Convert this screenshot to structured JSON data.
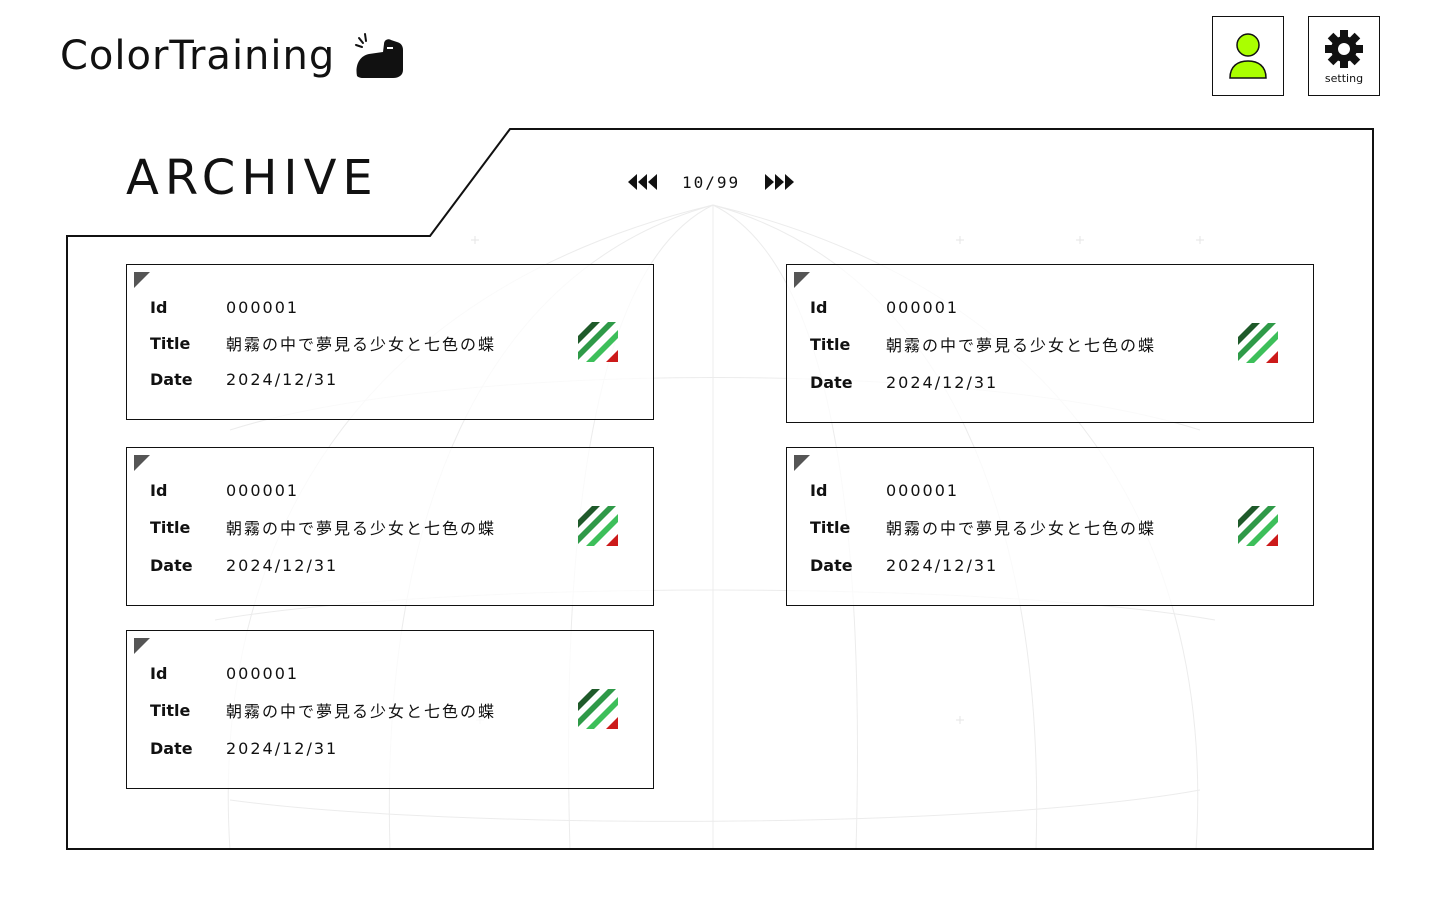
{
  "app": {
    "logo_text": "ColorTraining",
    "logo_icon": "flexed-arm-icon"
  },
  "header": {
    "user_icon": "user-icon",
    "user_icon_color": "#aaff00",
    "setting_icon": "gear-icon",
    "setting_label": "setting"
  },
  "archive": {
    "title": "ARCHIVE",
    "pager": {
      "text": "10/99",
      "prev_icon": "triple-chevron-left-icon",
      "next_icon": "triple-chevron-right-icon"
    },
    "labels": {
      "id": "Id",
      "title": "Title",
      "date": "Date"
    },
    "cards": [
      {
        "id": "000001",
        "title": "朝霧の中で夢見る少女と七色の蝶",
        "date": "2024/12/31"
      },
      {
        "id": "000001",
        "title": "朝霧の中で夢見る少女と七色の蝶",
        "date": "2024/12/31"
      },
      {
        "id": "000001",
        "title": "朝霧の中で夢見る少女と七色の蝶",
        "date": "2024/12/31"
      },
      {
        "id": "000001",
        "title": "朝霧の中で夢見る少女と七色の蝶",
        "date": "2024/12/31"
      },
      {
        "id": "000001",
        "title": "朝霧の中で夢見る少女と七色の蝶",
        "date": "2024/12/31"
      }
    ],
    "swatch_colors": [
      "#1f5a2a",
      "#2f9a48",
      "#3dbf5a",
      "#cc1a1a"
    ]
  }
}
